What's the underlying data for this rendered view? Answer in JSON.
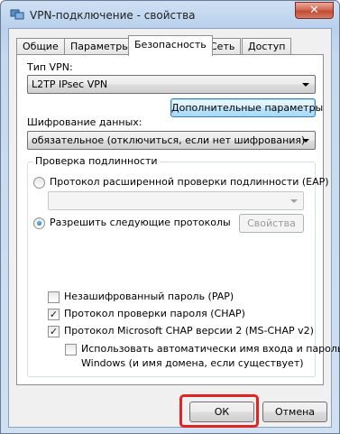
{
  "window": {
    "title": "VPN-подключение - свойства",
    "close_glyph": "✕"
  },
  "tabs": [
    {
      "label": "Общие",
      "active": false
    },
    {
      "label": "Параметры",
      "active": false
    },
    {
      "label": "Безопасность",
      "active": true
    },
    {
      "label": "Сеть",
      "active": false
    },
    {
      "label": "Доступ",
      "active": false
    }
  ],
  "vpn": {
    "type_label": "Тип VPN:",
    "type_value": "L2TP IPsec VPN",
    "advanced_button": "Дополнительные параметры"
  },
  "encryption": {
    "label": "Шифрование данных:",
    "value": "обязательное (отключиться, если нет шифрования)"
  },
  "auth": {
    "group_title": "Проверка подлинности",
    "eap_radio_label": "Протокол расширенной проверки подлинности (EAP)",
    "eap_radio_checked": false,
    "eap_combo_value": "",
    "allow_radio_label": "Разрешить следующие протоколы",
    "allow_radio_checked": true,
    "properties_button": "Свойства",
    "protocols": [
      {
        "label": "Незашифрованный пароль (PAP)",
        "checked": false
      },
      {
        "label": "Протокол проверки пароля (CHAP)",
        "checked": true
      },
      {
        "label": "Протокол Microsoft CHAP версии 2 (MS-CHAP v2)",
        "checked": true
      }
    ],
    "auto_logon_line1": "Использовать автоматически имя входа и пароль",
    "auto_logon_line2": "Windows (и имя домена, если существует)",
    "auto_logon_checked": false
  },
  "footer": {
    "ok_label": "ОК",
    "cancel_label": "Отмена"
  },
  "colors": {
    "highlight": "#e02424",
    "titlebar": "#b9d1ec"
  }
}
